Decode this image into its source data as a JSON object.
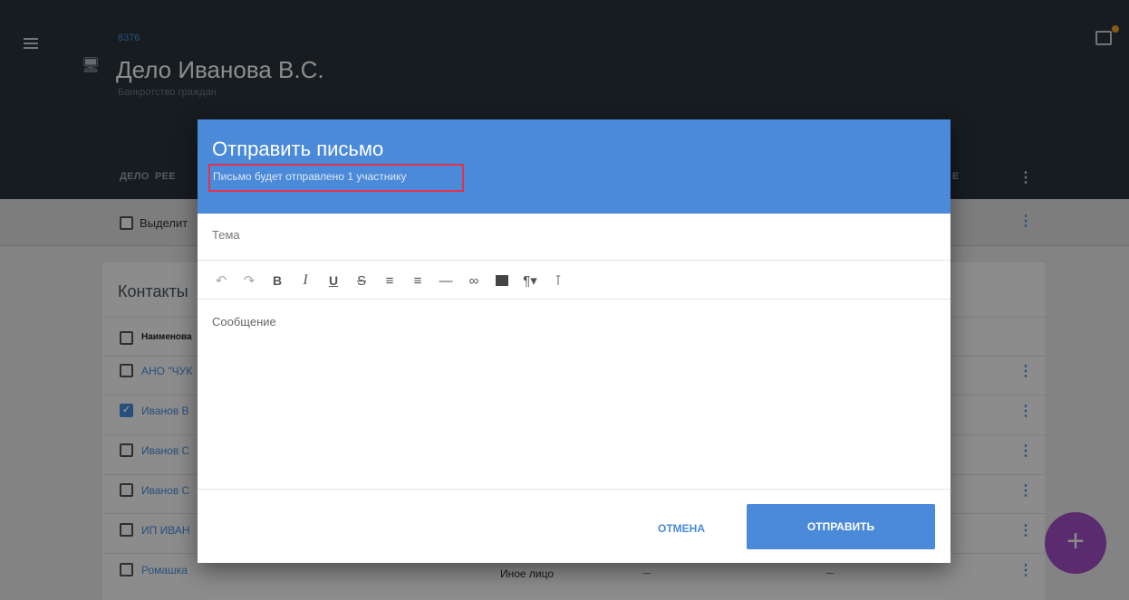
{
  "app": {
    "case_id": "8376",
    "case_title": "Дело Иванова В.С.",
    "case_subtitle": "Банкротство граждан"
  },
  "nav": {
    "tabs": [
      {
        "label": "ДЕЛО"
      },
      {
        "label": "РЕЕ"
      },
      {
        "label": "Е"
      }
    ]
  },
  "toolbar": {
    "select_all_label": "Выделит"
  },
  "contacts": {
    "title": "Контакты",
    "column_header": "Наименова",
    "rows": [
      {
        "name": "АНО \"ЧУК",
        "checked": false
      },
      {
        "name": "Иванов В",
        "checked": true
      },
      {
        "name": "Иванов С",
        "checked": false
      },
      {
        "name": "Иванов С",
        "checked": false
      },
      {
        "name": "ИП ИВАН",
        "checked": false
      },
      {
        "name": "Ромашка",
        "checked": false,
        "role": "Иное лицо",
        "col3": "–",
        "col4": "–"
      }
    ]
  },
  "fab": {
    "label": "+"
  },
  "dialog": {
    "title": "Отправить письмо",
    "subtitle": "Письмо будет отправлено 1 участнику",
    "subject_placeholder": "Тема",
    "message_placeholder": "Сообщение",
    "editor_tools": [
      "undo-icon",
      "redo-icon",
      "bold-icon",
      "italic-icon",
      "underline-icon",
      "strikethrough-icon",
      "bulleted-list-icon",
      "numbered-list-icon",
      "horizontal-rule-icon",
      "link-icon",
      "image-icon",
      "paragraph-format-icon",
      "clear-format-icon"
    ],
    "cancel_label": "ОТМЕНА",
    "send_label": "ОТПРАВИТЬ"
  },
  "colors": {
    "header_bg": "#2b333c",
    "accent": "#4a8ad9",
    "highlight": "#e0334c",
    "fab": "#a54fc8"
  }
}
